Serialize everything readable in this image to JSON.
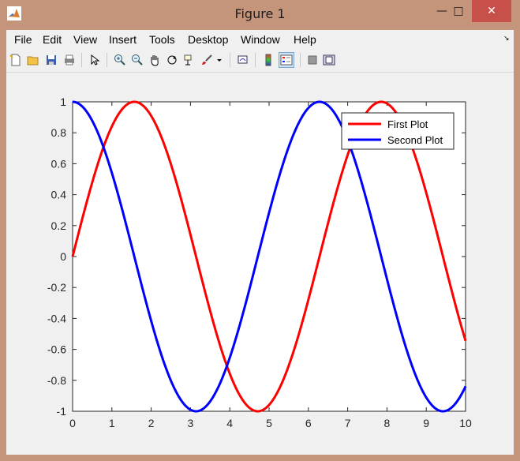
{
  "window": {
    "title": "Figure 1"
  },
  "menu": [
    "File",
    "Edit",
    "View",
    "Insert",
    "Tools",
    "Desktop",
    "Window",
    "Help"
  ],
  "toolbar": [
    "new-figure-icon",
    "open-file-icon",
    "save-icon",
    "print-icon",
    "pointer-icon",
    "zoom-in-icon",
    "zoom-out-icon",
    "pan-hand-icon",
    "rotate-3d-icon",
    "data-cursor-icon",
    "brush-icon",
    "link-plot-icon",
    "colorbar-icon",
    "legend-icon",
    "hide-plot-tools-icon",
    "show-plot-tools-icon"
  ],
  "colors": {
    "first": "#ff0000",
    "second": "#0000ff",
    "title_bar": "#c4957a",
    "close": "#c7504a"
  },
  "chart_data": {
    "type": "line",
    "x_range": [
      0,
      10
    ],
    "y_range": [
      -1,
      1
    ],
    "xticks": [
      "0",
      "1",
      "2",
      "3",
      "4",
      "5",
      "6",
      "7",
      "8",
      "9",
      "10"
    ],
    "yticks": [
      "1",
      "0.8",
      "0.6",
      "0.4",
      "0.2",
      "0",
      "-0.2",
      "-0.4",
      "-0.6",
      "-0.8",
      "-1"
    ],
    "grid": false,
    "legend_position": "top-right",
    "series": [
      {
        "name": "First Plot",
        "color": "#ff0000",
        "function": "sin(x)",
        "x": [
          0,
          0.5,
          1,
          1.5,
          1.57,
          2,
          2.5,
          3,
          3.5,
          4,
          4.5,
          4.71,
          5,
          5.5,
          6,
          6.5,
          7,
          7.5,
          7.85,
          8,
          8.5,
          9,
          9.5,
          10
        ],
        "y": [
          0,
          0.48,
          0.84,
          1.0,
          1.0,
          0.91,
          0.6,
          0.14,
          -0.35,
          -0.76,
          -0.98,
          -1.0,
          -0.96,
          -0.71,
          -0.28,
          0.22,
          0.66,
          0.94,
          1.0,
          0.99,
          0.8,
          0.41,
          -0.08,
          -0.54
        ]
      },
      {
        "name": "Second Plot",
        "color": "#0000ff",
        "function": "cos(x)",
        "x": [
          0,
          0.5,
          1,
          1.5,
          2,
          2.5,
          3,
          3.14,
          3.5,
          4,
          4.5,
          5,
          5.5,
          6,
          6.28,
          6.5,
          7,
          7.5,
          8,
          8.5,
          9,
          9.42,
          9.5,
          10
        ],
        "y": [
          1.0,
          0.88,
          0.54,
          0.07,
          -0.42,
          -0.8,
          -0.99,
          -1.0,
          -0.94,
          -0.65,
          -0.21,
          0.28,
          0.71,
          0.96,
          1.0,
          0.98,
          0.75,
          0.35,
          -0.15,
          -0.6,
          -0.91,
          -1.0,
          -1.0,
          -0.84
        ]
      }
    ]
  }
}
